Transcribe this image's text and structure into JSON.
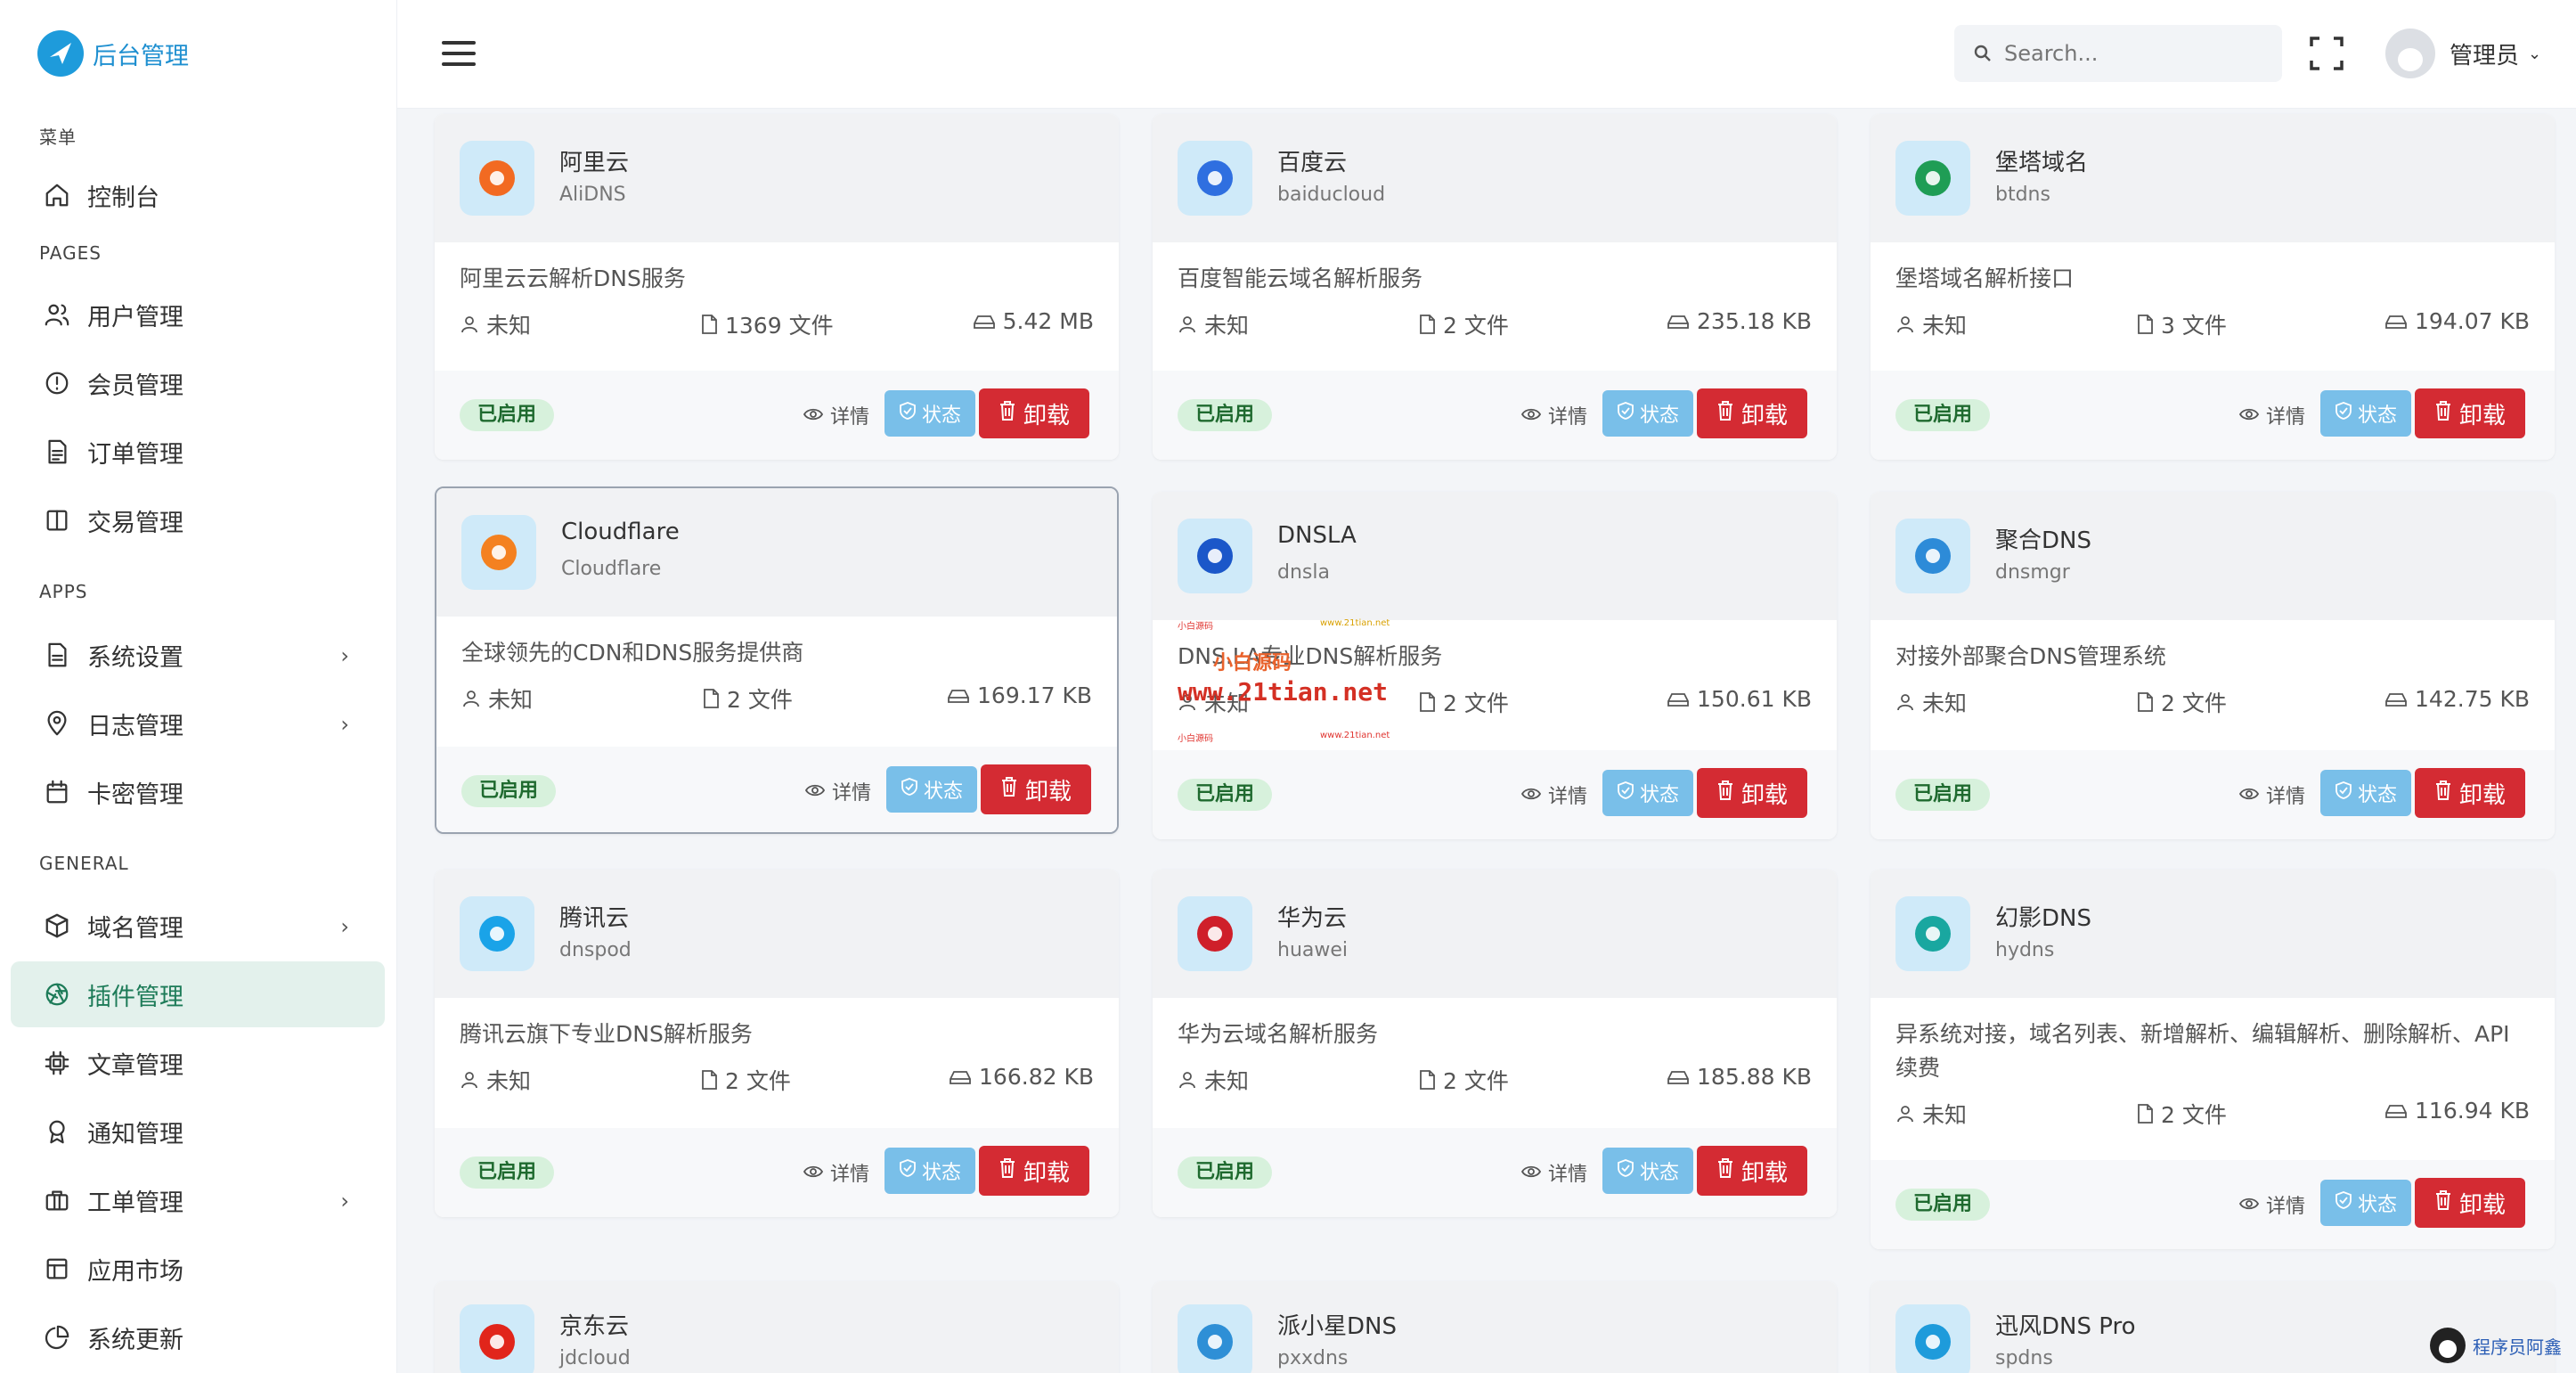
{
  "brand": {
    "title": "后台管理"
  },
  "sidebar": {
    "sections": {
      "menu": "菜单",
      "pages": "PAGES",
      "apps": "APPS",
      "general": "GENERAL"
    },
    "items": [
      {
        "label": "控制台",
        "icon": "home-icon"
      },
      {
        "label": "用户管理",
        "icon": "users-icon"
      },
      {
        "label": "会员管理",
        "icon": "alert-circle-icon"
      },
      {
        "label": "订单管理",
        "icon": "file-text-icon"
      },
      {
        "label": "交易管理",
        "icon": "columns-icon"
      },
      {
        "label": "系统设置",
        "icon": "file-icon",
        "chevron": "›"
      },
      {
        "label": "日志管理",
        "icon": "map-pin-icon",
        "chevron": "›"
      },
      {
        "label": "卡密管理",
        "icon": "calendar-icon"
      },
      {
        "label": "域名管理",
        "icon": "package-icon",
        "chevron": "›"
      },
      {
        "label": "插件管理",
        "icon": "aperture-icon",
        "active": true
      },
      {
        "label": "文章管理",
        "icon": "cpu-icon"
      },
      {
        "label": "通知管理",
        "icon": "award-icon"
      },
      {
        "label": "工单管理",
        "icon": "briefcase-icon",
        "chevron": "›"
      },
      {
        "label": "应用市场",
        "icon": "layout-icon"
      },
      {
        "label": "系统更新",
        "icon": "pie-chart-icon"
      }
    ]
  },
  "header": {
    "search_placeholder": "Search...",
    "user_name": "管理员",
    "caret": "⌄"
  },
  "common": {
    "badge": "已启用",
    "detail": "详情",
    "status": "状态",
    "uninstall": "卸载",
    "author": "未知"
  },
  "plugins": [
    {
      "name": "阿里云",
      "id": "AliDNS",
      "desc": "阿里云云解析DNS服务",
      "files": "1369 文件",
      "size": "5.42 MB",
      "icon_color": "#f26a22"
    },
    {
      "name": "百度云",
      "id": "baiducloud",
      "desc": "百度智能云域名解析服务",
      "files": "2 文件",
      "size": "235.18 KB",
      "icon_color": "#2f6fe0"
    },
    {
      "name": "堡塔域名",
      "id": "btdns",
      "desc": "堡塔域名解析接口",
      "files": "3 文件",
      "size": "194.07 KB",
      "icon_color": "#1f9d55"
    },
    {
      "name": "Cloudflare",
      "id": "Cloudflare",
      "desc": "全球领先的CDN和DNS服务提供商",
      "files": "2 文件",
      "size": "169.17 KB",
      "icon_color": "#f48120"
    },
    {
      "name": "DNSLA",
      "id": "dnsla",
      "desc": "DNS.LA专业DNS解析服务",
      "files": "2 文件",
      "size": "150.61 KB",
      "icon_color": "#1b57c9"
    },
    {
      "name": "聚合DNS",
      "id": "dnsmgr",
      "desc": "对接外部聚合DNS管理系统",
      "files": "2 文件",
      "size": "142.75 KB",
      "icon_color": "#2d8bd8"
    },
    {
      "name": "腾讯云",
      "id": "dnspod",
      "desc": "腾讯云旗下专业DNS解析服务",
      "files": "2 文件",
      "size": "166.82 KB",
      "icon_color": "#1aa3e8"
    },
    {
      "name": "华为云",
      "id": "huawei",
      "desc": "华为云域名解析服务",
      "files": "2 文件",
      "size": "185.88 KB",
      "icon_color": "#cf1f2a"
    },
    {
      "name": "幻影DNS",
      "id": "hydns",
      "desc": "异系统对接，域名列表、新增解析、编辑解析、删除解析、API续费",
      "files": "2 文件",
      "size": "116.94 KB",
      "icon_color": "#19a7a0"
    },
    {
      "name": "京东云",
      "id": "jdcloud",
      "icon_color": "#e1251b"
    },
    {
      "name": "派小星DNS",
      "id": "pxxdns",
      "icon_color": "#2e8fd6"
    },
    {
      "name": "迅风DNS Pro",
      "id": "spdns",
      "icon_color": "#1e9bdb"
    }
  ],
  "watermark": {
    "big": "www.21tian.net",
    "mid": "小白源码",
    "small_a": "小白源码",
    "small_b": "www.21tian.net"
  },
  "corner_brand": "程序员阿鑫"
}
